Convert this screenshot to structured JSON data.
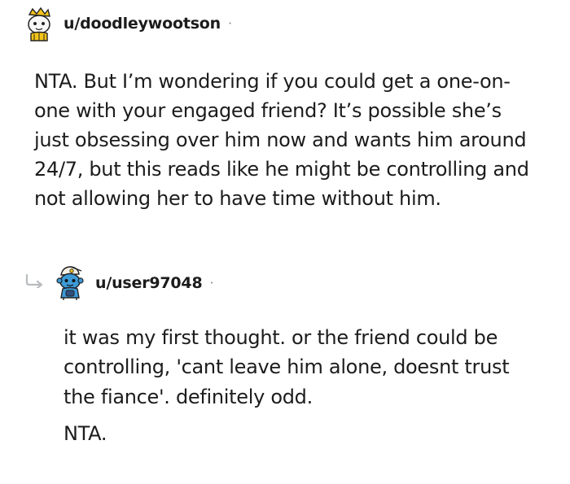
{
  "comment": {
    "username": "u/doodleywootson",
    "separator": "·",
    "avatar_icon": "snoo-avatar-yellow-hat-icon",
    "body_lines": [
      "NTA. But I’m wondering if you could get a one-on-",
      "one with your engaged friend? It’s possible she’s",
      "just obsessing over him now and wants him around",
      "24/7, but this reads like he might be controlling and",
      "not allowing her to have time without him."
    ]
  },
  "reply": {
    "indicator_icon": "reply-arrow-icon",
    "username": "u/user97048",
    "separator": "·",
    "avatar_icon": "snoo-avatar-blue-cap-icon",
    "body_lines": [
      "it was my first thought. or the friend could be",
      "controlling, 'cant leave him alone, doesnt trust",
      "the fiance'. definitely odd."
    ],
    "closing": "NTA."
  },
  "colors": {
    "text": "#1c1c1c",
    "meta": "#878a8c",
    "avatar_skin": "#f3f3f3",
    "hat_yellow": "#f5c518",
    "reply_blue": "#3d9bd8"
  }
}
